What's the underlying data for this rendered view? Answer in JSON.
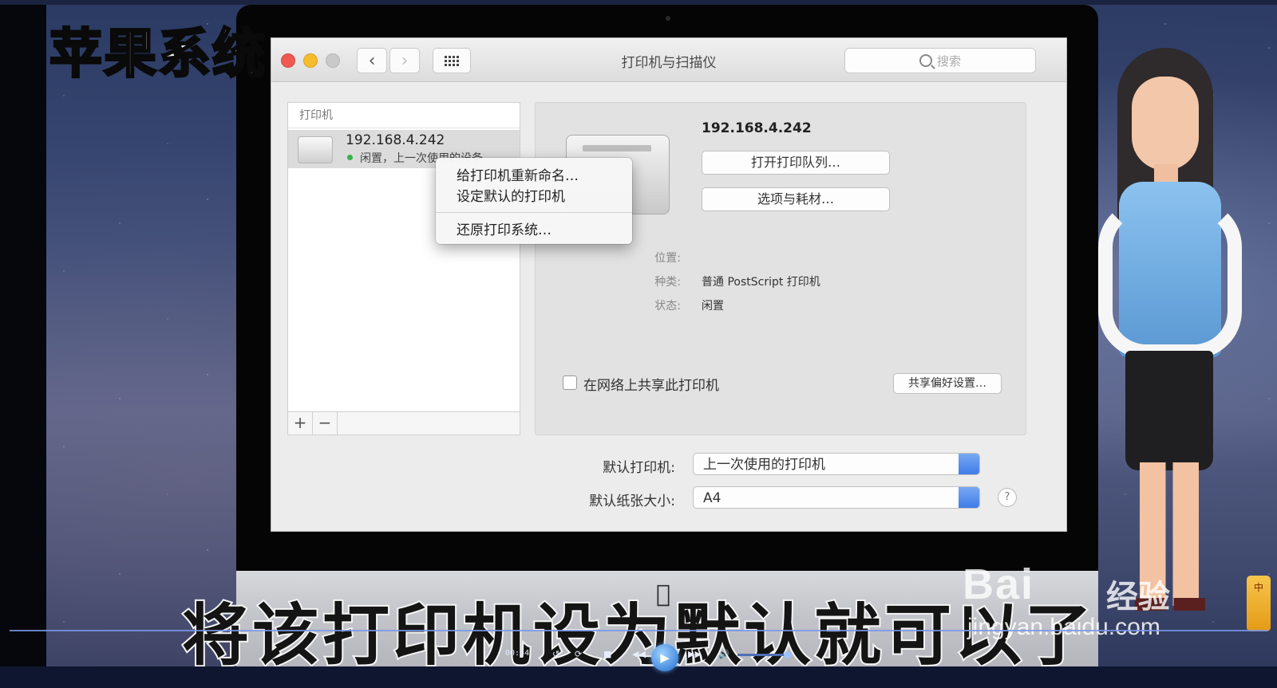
{
  "overlay": {
    "top_caption": "苹果系统",
    "subtitle": "将该打印机设为默认就可以了"
  },
  "window": {
    "title": "打印机与扫描仪",
    "search_placeholder": "搜索",
    "nav_back_icon": "chevron-left-icon",
    "nav_forward_icon": "chevron-right-icon",
    "show_all_icon": "grid-icon"
  },
  "printer_list": {
    "header": "打印机",
    "items": [
      {
        "name": "192.168.4.242",
        "status": "闲置，上一次使用的设备",
        "status_color": "#36b34a",
        "selected": true
      }
    ],
    "add_label": "+",
    "remove_label": "−"
  },
  "context_menu": {
    "items": [
      {
        "label": "给打印机重新命名…"
      },
      {
        "label": "设定默认的打印机"
      },
      {
        "label": "还原打印系统…"
      }
    ]
  },
  "detail": {
    "name": "192.168.4.242",
    "open_queue_button": "打开打印队列…",
    "options_button": "选项与耗材…",
    "location_label": "位置:",
    "location_value": "",
    "kind_label": "种类:",
    "kind_value": "普通 PostScript 打印机",
    "status_label": "状态:",
    "status_value": "闲置",
    "share_checkbox_label": "在网络上共享此打印机",
    "share_checked": false,
    "share_prefs_button": "共享偏好设置…"
  },
  "defaults": {
    "default_printer_label": "默认打印机:",
    "default_printer_value": "上一次使用的打印机",
    "default_paper_label": "默认纸张大小:",
    "default_paper_value": "A4",
    "help_label": "?"
  },
  "watermark": {
    "logo": "Bai",
    "brand": "经验",
    "url": "jingyan.baidu.com"
  },
  "side_badge": {
    "text": "中"
  },
  "player": {
    "time": "00:44"
  },
  "colors": {
    "close": "#ee5a52",
    "minimize": "#f5bd2e",
    "zoom": "#c9c9c9",
    "popup_accent": "#3f7ce8"
  }
}
